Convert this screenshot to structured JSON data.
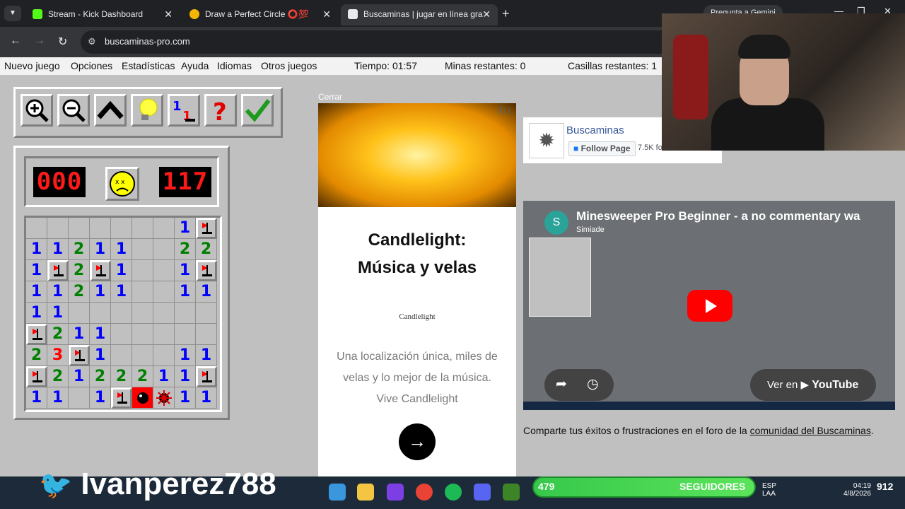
{
  "browser": {
    "tabs": [
      {
        "title": "Stream - Kick Dashboard",
        "favicon_color": "#53fc18"
      },
      {
        "title": "Draw a Perfect Circle ⭕💯",
        "favicon_color": "#f2b705"
      },
      {
        "title": "Buscaminas | jugar en línea gra",
        "favicon_color": "#e8eaed"
      }
    ],
    "active_tab": 2,
    "gemini_label": "Pregunta a Gemini",
    "url": "buscaminas-pro.com"
  },
  "menu": {
    "items": [
      "Nuevo juego",
      "Opciones",
      "Estadísticas",
      "Ayuda",
      "Idiomas",
      "Otros juegos"
    ],
    "time": "Tiempo: 01:57",
    "mines": "Minas restantes: 0",
    "cells": "Casillas restantes: 1"
  },
  "toolbar": {
    "icons": [
      "zoom-in-icon",
      "zoom-out-icon",
      "collapse-icon",
      "hint-lightbulb-icon",
      "flag-numbers-icon",
      "help-question-icon",
      "check-icon"
    ]
  },
  "game": {
    "mine_counter": "000",
    "timer": "117",
    "face": "dead",
    "number_colors": {
      "1": "#0000ff",
      "2": "#008000",
      "3": "#ff0000"
    },
    "rows": [
      [
        "e",
        "e",
        "e",
        "e",
        "e",
        "e",
        "e",
        "1",
        "F"
      ],
      [
        "1",
        "1",
        "2",
        "1",
        "1",
        "e",
        "e",
        "2",
        "2"
      ],
      [
        "1",
        "F",
        "2",
        "F",
        "1",
        "e",
        "e",
        "1",
        "F"
      ],
      [
        "1",
        "1",
        "2",
        "1",
        "1",
        "e",
        "e",
        "1",
        "1"
      ],
      [
        "1",
        "1",
        "e",
        "e",
        "e",
        "e",
        "e",
        "e",
        "e"
      ],
      [
        "F",
        "2",
        "1",
        "1",
        "e",
        "e",
        "e",
        "e",
        "e"
      ],
      [
        "2",
        "3",
        "F",
        "1",
        "e",
        "e",
        "e",
        "1",
        "1"
      ],
      [
        "F",
        "2",
        "1",
        "2",
        "2",
        "2",
        "1",
        "1",
        "F"
      ],
      [
        "1",
        "1",
        "e",
        "1",
        "F",
        "X",
        "M",
        "1",
        "1"
      ]
    ]
  },
  "ad": {
    "close_label": "Cerrar",
    "title_line1": "Candlelight:",
    "title_line2": "Música y velas",
    "brand": "Candlelight",
    "description": "Una localización única, miles de velas y lo mejor de la música. Vive Candlelight",
    "arrow": "→"
  },
  "facebook": {
    "page_name": "Buscaminas",
    "follow_label": "Follow Page",
    "followers": "7.5K followers"
  },
  "video": {
    "channel_initial": "S",
    "title": "Minesweeper Pro Beginner - a no commentary wa",
    "channel": "Simiade",
    "watch_on": "Ver en",
    "brand": "YouTube"
  },
  "comment": {
    "text": "Comparte tus éxitos o frustraciones en el foro de la ",
    "link": "comunidad del Buscaminas",
    "end": "."
  },
  "overlay": {
    "twitter_handle": "Ivanperez788",
    "followers_count": "479",
    "followers_label": "SEGUIDORES",
    "goal": "912",
    "lang": "ESP",
    "lang2": "LAA",
    "clock": "04:19",
    "date": "4/8/2026"
  }
}
